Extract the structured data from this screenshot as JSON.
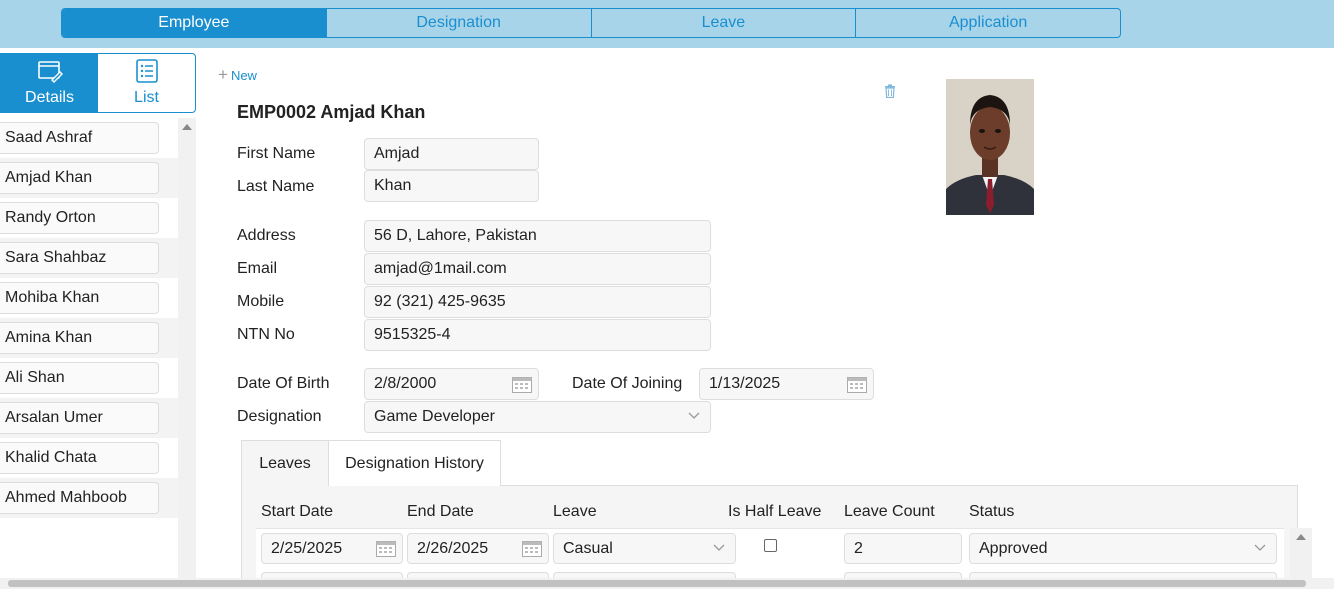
{
  "top_tabs": [
    {
      "label": "Employee",
      "active": true
    },
    {
      "label": "Designation",
      "active": false
    },
    {
      "label": "Leave",
      "active": false
    },
    {
      "label": "Application",
      "active": false
    }
  ],
  "view_tabs": {
    "details": {
      "label": "Details",
      "icon": "details-window-icon",
      "active": true
    },
    "list": {
      "label": "List",
      "icon": "list-icon",
      "active": false
    }
  },
  "employees": [
    "Saad Ashraf",
    "Amjad Khan",
    "Randy Orton",
    "Sara Shahbaz",
    "Mohiba Khan",
    "Amina Khan",
    "Ali Shan",
    "Arsalan Umer",
    "Khalid Chata",
    "Ahmed Mahboob"
  ],
  "toolbar": {
    "new_label": "New",
    "new_icon": "plus-icon",
    "delete_icon": "trash-icon"
  },
  "record": {
    "title": "EMP0002 Amjad Khan",
    "photo_icon": "employee-photo",
    "fields": {
      "first_name": {
        "label": "First Name",
        "value": "Amjad"
      },
      "last_name": {
        "label": "Last Name",
        "value": "Khan"
      },
      "address": {
        "label": "Address",
        "value": "56 D, Lahore, Pakistan"
      },
      "email": {
        "label": "Email",
        "value": "amjad@1mail.com"
      },
      "mobile": {
        "label": "Mobile",
        "value": "92 (321) 425-9635"
      },
      "ntn": {
        "label": "NTN No",
        "value": "9515325-4"
      },
      "dob": {
        "label": "Date Of Birth",
        "value": "2/8/2000"
      },
      "doj": {
        "label": "Date Of Joining",
        "value": "1/13/2025"
      },
      "designation": {
        "label": "Designation",
        "value": "Game Developer"
      }
    }
  },
  "sub_tabs": [
    {
      "label": "Leaves",
      "active": false
    },
    {
      "label": "Designation History",
      "active": true
    }
  ],
  "leaves_grid": {
    "columns": [
      "Start Date",
      "End Date",
      "Leave",
      "Is Half Leave",
      "Leave Count",
      "Status"
    ],
    "rows": [
      {
        "start": "2/25/2025",
        "end": "2/26/2025",
        "leave": "Casual",
        "half": false,
        "count": "2",
        "status": "Approved"
      }
    ]
  },
  "colors": {
    "accent": "#1a8fd0",
    "topbar_bg": "#a8d4ea"
  }
}
